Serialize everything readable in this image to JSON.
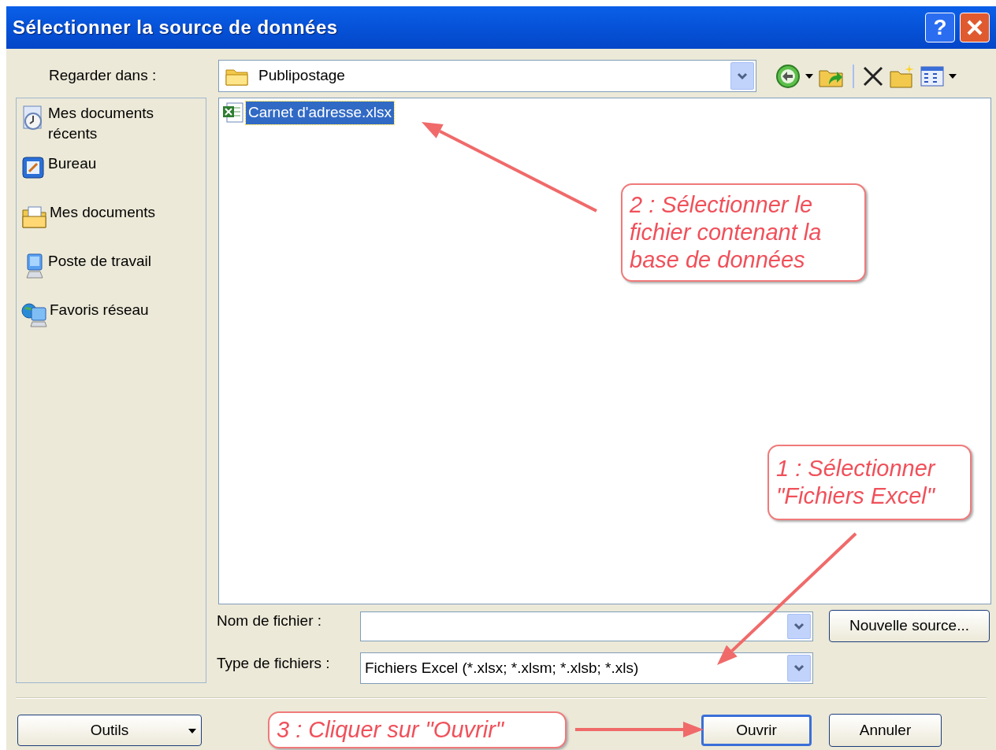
{
  "window": {
    "title": "Sélectionner la source de données",
    "title_buttons": [
      {
        "kind": "help",
        "text": "?"
      },
      {
        "kind": "close"
      }
    ]
  },
  "look_in": {
    "label": "Regarder dans :",
    "value": "Publipostage"
  },
  "toolbar": [
    {
      "kind": "back",
      "dropdown": true
    },
    {
      "kind": "up",
      "dropdown": false
    },
    {
      "kind": "separator"
    },
    {
      "kind": "delete",
      "dropdown": false
    },
    {
      "kind": "new_folder",
      "dropdown": false
    },
    {
      "kind": "views",
      "dropdown": true
    }
  ],
  "places": [
    {
      "kind": "recent",
      "label": "Mes documents récents"
    },
    {
      "kind": "desktop",
      "label": "Bureau"
    },
    {
      "kind": "documents",
      "label": "Mes documents"
    },
    {
      "kind": "computer",
      "label": "Poste de travail"
    },
    {
      "kind": "network",
      "label": "Favoris réseau"
    }
  ],
  "files": [
    {
      "name": "Carnet d'adresse.xlsx",
      "selected": true
    }
  ],
  "file_name": {
    "label": "Nom de fichier :"
  },
  "file_type": {
    "label": "Type de fichiers :",
    "value": "Fichiers Excel (*.xlsx; *.xlsm; *.xlsb; *.xls)"
  },
  "buttons": [
    {
      "kind": "new_source",
      "label": "Nouvelle source...",
      "default": false,
      "dropdown": false
    },
    {
      "kind": "tools",
      "label": "Outils",
      "default": false,
      "dropdown": true
    },
    {
      "kind": "open",
      "label": "Ouvrir",
      "default": true,
      "dropdown": false
    },
    {
      "kind": "cancel",
      "label": "Annuler",
      "default": false,
      "dropdown": false
    }
  ],
  "annotations": [
    {
      "text": "2 : Sélectionner le fichier contenant la base de données"
    },
    {
      "text": "1 : Sélectionner \"Fichiers Excel\""
    },
    {
      "text": "3 : Cliquer sur \"Ouvrir\""
    }
  ]
}
